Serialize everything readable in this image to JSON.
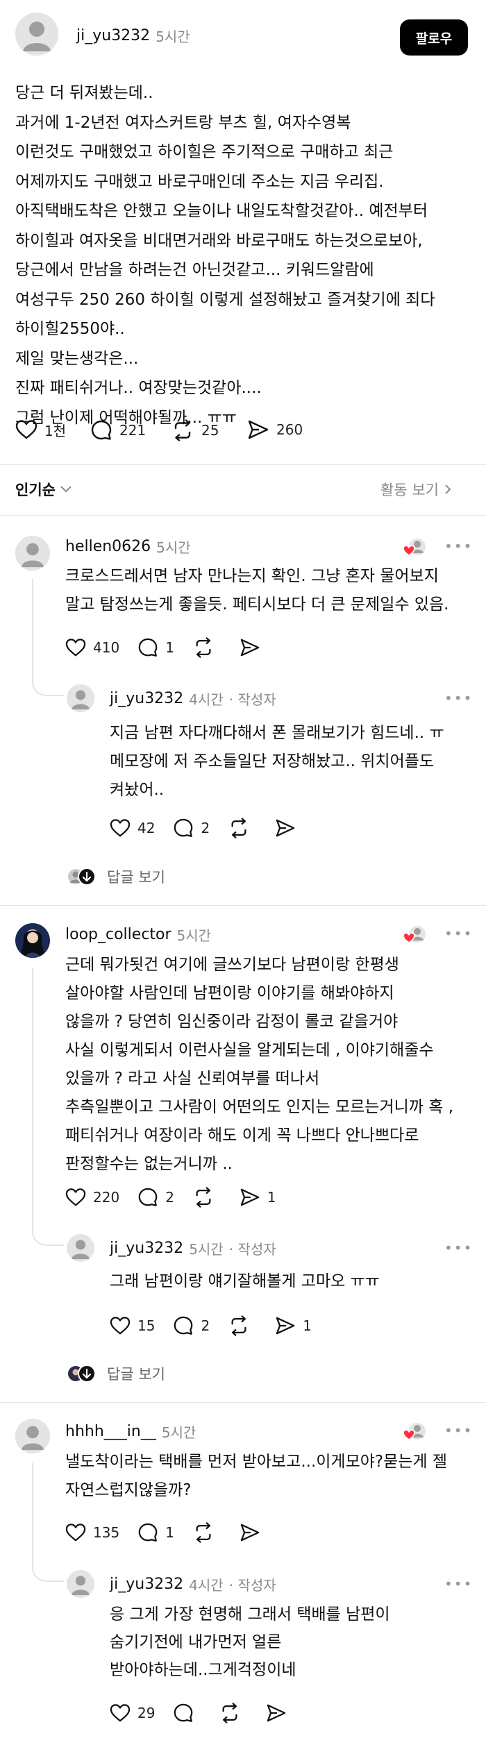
{
  "post": {
    "username": "ji_yu3232",
    "time": "5시간",
    "follow_label": "팔로우",
    "text": "당근 더 뒤져봤는데..\n과거에 1-2년전 여자스커트랑 부츠 힐, 여자수영복\n이런것도 구매했었고 하이힐은 주기적으로 구매하고  최근\n어제까지도 구매했고 바로구매인데 주소는 지금 우리집.\n아직택배도착은 안했고 오늘이나 내일도착할것같아.. 예전부터\n하이힐과 여자옷을 비대면거래와 바로구매도 하는것으로보아,\n당근에서 만남을 하려는건 아닌것같고... 키워드알람에\n여성구두 250 260 하이힐 이렇게 설정해놨고 즐겨찾기에 죄다\n하이힐2550야..\n제일 맞는생각은...\n진짜 패티쉬거나.. 여장맞는것같아....\n그럼 난이제 어떡해야될까... ㅠㅠ",
    "likes": "1천",
    "comments": "221",
    "reposts": "25",
    "shares": "260"
  },
  "sort": {
    "label": "인기순",
    "activity_label": "활동 보기"
  },
  "threads": [
    {
      "username": "hellen0626",
      "time": "5시간",
      "text": "크로스드레서면 남자 만나는지 확인. 그냥 혼자 물어보지\n말고 탐정쓰는게 좋을듯. 페티시보다 더 큰 문제일수 있음.",
      "likes": "410",
      "comments": "1",
      "reposts": "",
      "shares": "",
      "reply": {
        "username": "ji_yu3232",
        "time": "4시간",
        "author_tag": "· 작성자",
        "text": "지금 남편 자다깨다해서 폰 몰래보기가 힘드네.. ㅠ\n메모장에 저 주소들일단 저장해놨고.. 위치어플도\n켜놨어..",
        "likes": "42",
        "comments": "2",
        "reposts": "",
        "shares": ""
      },
      "more_replies": "답글 보기"
    },
    {
      "username": "loop_collector",
      "time": "5시간",
      "text": "근데 뭐가됫건 여기에 글쓰기보다 남편이랑 한평생\n살아야할 사람인데 남편이랑 이야기를 해봐야하지\n않을까 ? 당연히 임신중이라 감정이 롤코 같을거야\n사실 이렇게되서 이런사실을 알게되는데 , 이야기해줄수\n있을까 ? 라고 사실 신뢰여부를 떠나서\n추측일뿐이고 그사람이 어떤의도 인지는 모르는거니까 혹 ,\n패티쉬거나 여장이라 해도 이게 꼭 나쁘다 안나쁘다로\n판정할수는 없는거니까 ..",
      "likes": "220",
      "comments": "2",
      "reposts": "",
      "shares": "1",
      "reply": {
        "username": "ji_yu3232",
        "time": "5시간",
        "author_tag": "· 작성자",
        "text": "그래 남편이랑 얘기잘해볼게 고마오 ㅠㅠ",
        "likes": "15",
        "comments": "2",
        "reposts": "",
        "shares": "1"
      },
      "more_replies": "답글 보기"
    },
    {
      "username": "hhhh___in__",
      "time": "5시간",
      "text": "낼도착이라는 택배를 먼저 받아보고...이게모야?묻는게 젤\n자연스럽지않을까?",
      "likes": "135",
      "comments": "1",
      "reposts": "",
      "shares": "",
      "reply": {
        "username": "ji_yu3232",
        "time": "4시간",
        "author_tag": "· 작성자",
        "text": "응 그게 가장 현명해 그래서 택배를 남편이\n숨기기전에 내가먼저 얼른\n받아야하는데..그게걱정이네",
        "likes": "29",
        "comments": "",
        "reposts": "",
        "shares": ""
      }
    }
  ],
  "more_label": "•••",
  "colors": {
    "heart_red": "#ff3040",
    "text": "#101010",
    "muted": "#8a8a8a",
    "follow_bg": "#000000"
  }
}
